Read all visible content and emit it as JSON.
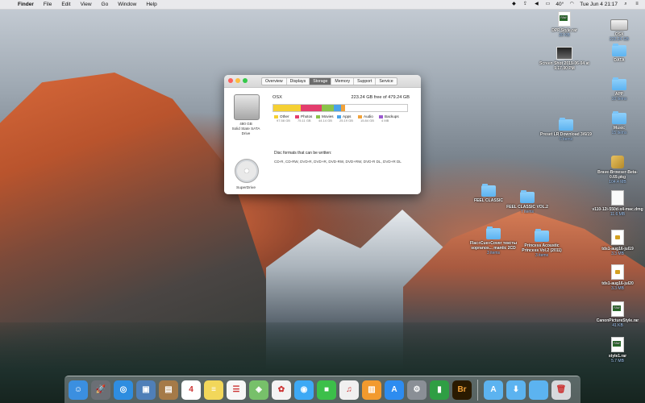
{
  "menubar": {
    "apple": "",
    "items": [
      "Finder",
      "File",
      "Edit",
      "View",
      "Go",
      "Window",
      "Help"
    ],
    "battery": "40°",
    "clock": "Tue Jun 4  21:17"
  },
  "desktop": {
    "icons": [
      {
        "label": "DPP Style.rar",
        "sub": "20 KB",
        "kind": "raw"
      },
      {
        "label": "OSX",
        "sub": "223.24 GB",
        "kind": "drive"
      },
      {
        "label": "Screen Shot 2019-06-04 at 9.17.00 PM",
        "sub": "",
        "kind": "img"
      },
      {
        "label": "DATA",
        "sub": "",
        "kind": "folder"
      },
      {
        "label": "APP",
        "sub": "10 items",
        "kind": "folder"
      },
      {
        "label": "Music",
        "sub": "15 items",
        "kind": "folder"
      },
      {
        "label": "Preset LR Download 3/6/19",
        "sub": "6 items",
        "kind": "folder"
      },
      {
        "label": "Brave-Browser-Beta-0.69.pkg",
        "sub": "104.4 MB",
        "kind": "pkg"
      },
      {
        "label": "FEEL CLASSIC",
        "sub": "",
        "kind": "folder"
      },
      {
        "label": "FEEL CLASSIC VOL.2",
        "sub": "7 items",
        "kind": "folder"
      },
      {
        "label": "v110-12i-550d-x4-mac.dmg",
        "sub": "11.6 MB",
        "kind": "doc"
      },
      {
        "label": "Flac+Cue+Cover тексты sopranos... mantic 2CD",
        "sub": "3 items",
        "kind": "folder"
      },
      {
        "label": "Princess Acoustic Princess Vol.2 (2011)",
        "sub": "3 items",
        "kind": "folder"
      },
      {
        "label": "tds1-aug16-jul19",
        "sub": "3.3 MB",
        "kind": "lock"
      },
      {
        "label": "tds1-aug16-jul20",
        "sub": "3.3 MB",
        "kind": "lock"
      },
      {
        "label": "CanonPictureStyle.rar",
        "sub": "41 KB",
        "kind": "raw"
      },
      {
        "label": "style1.rar",
        "sub": "5.7 MB",
        "kind": "raw"
      }
    ]
  },
  "window": {
    "tabs": [
      "Overview",
      "Displays",
      "Storage",
      "Memory",
      "Support",
      "Service"
    ],
    "active_tab": "Storage",
    "disk": {
      "size": "480 GB",
      "type": "Solid State SATA",
      "type2": "Drive"
    },
    "optical": {
      "name": "SuperDrive"
    },
    "volume": "OSX",
    "free_text": "223.24 GB free of 479.24 GB",
    "segments": [
      {
        "name": "Other",
        "size": "97.58 GB",
        "color": "#f5d033",
        "fraction": 0.204
      },
      {
        "name": "Photos",
        "size": "75.11 GB",
        "color": "#e33d6d",
        "fraction": 0.157
      },
      {
        "name": "Movies",
        "size": "44.14 GB",
        "color": "#8bc34a",
        "fraction": 0.092
      },
      {
        "name": "Apps",
        "size": "25.19 GB",
        "color": "#4aa3ea",
        "fraction": 0.053
      },
      {
        "name": "Audio",
        "size": "15.84 GB",
        "color": "#f2a23a",
        "fraction": 0.033
      },
      {
        "name": "Backups",
        "size": "4 MB",
        "color": "#9b59d0",
        "fraction": 0.0
      }
    ],
    "formats_title": "Disc formats that can be written:",
    "formats_list": "CD-R, CD-RW, DVD-R, DVD+R, DVD-RW, DVD+RW, DVD-R DL, DVD+R DL"
  },
  "dock": {
    "apps": [
      {
        "name": "Finder",
        "color": "#3b8fe0",
        "glyph": "☺"
      },
      {
        "name": "Launchpad",
        "color": "#6b6f75",
        "glyph": "🚀"
      },
      {
        "name": "Safari",
        "color": "#2e8de0",
        "glyph": "◎"
      },
      {
        "name": "Preview",
        "color": "#4f7fb8",
        "glyph": "▣"
      },
      {
        "name": "Notefile",
        "color": "#a57a48",
        "glyph": "▤"
      },
      {
        "name": "Calendar",
        "color": "#ffffff",
        "glyph": "4"
      },
      {
        "name": "Notes",
        "color": "#f2d75a",
        "glyph": "≡"
      },
      {
        "name": "Reminders",
        "color": "#f7f7f7",
        "glyph": "☰"
      },
      {
        "name": "Maps",
        "color": "#77c06a",
        "glyph": "◈"
      },
      {
        "name": "Photos",
        "color": "#f3f3f3",
        "glyph": "✿"
      },
      {
        "name": "Messages",
        "color": "#3da9f5",
        "glyph": "◉"
      },
      {
        "name": "FaceTime",
        "color": "#3cbf4a",
        "glyph": "■"
      },
      {
        "name": "iTunes",
        "color": "#f0f0f0",
        "glyph": "♫"
      },
      {
        "name": "iBooks",
        "color": "#f29a2e",
        "glyph": "▥"
      },
      {
        "name": "App Store",
        "color": "#2d8cf0",
        "glyph": "A"
      },
      {
        "name": "System Preferences",
        "color": "#8a8f96",
        "glyph": "⚙"
      },
      {
        "name": "Numbers",
        "color": "#2f9e44",
        "glyph": "▮"
      },
      {
        "name": "Bridge",
        "color": "#2a1a00",
        "glyph": "Br"
      }
    ],
    "stacks": [
      {
        "name": "Applications",
        "color": "#5cb3f0",
        "glyph": "A"
      },
      {
        "name": "Downloads",
        "color": "#5cb3f0",
        "glyph": "⬇"
      },
      {
        "name": "Documents",
        "color": "#5cb3f0",
        "glyph": ""
      }
    ],
    "trash": {
      "name": "Trash",
      "color": "#d7d9dc",
      "glyph": "🗑"
    }
  }
}
